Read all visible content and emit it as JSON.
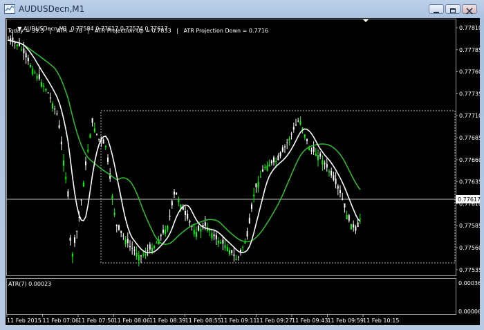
{
  "window": {
    "title": "AUDUSDecn,M1"
  },
  "main_chart": {
    "header_line1": "AUDUSDecn,M1  0.77584 0.77617 0.77574 0.77617",
    "header_line2": "Today = 39.5   |   ATR = 78   |   ATR Projection Up = 0.7833   |   ATR Projection Down = 0.7716",
    "price_labels": [
      "0.77810",
      "0.77785",
      "0.77760",
      "0.77735",
      "0.77710",
      "0.77685",
      "0.77660",
      "0.77635",
      "0.77610",
      "0.77585",
      "0.77560",
      "0.77535"
    ],
    "current_price": "0.77617",
    "colors": {
      "background": "#000000",
      "bull_candle": "#00ff00",
      "bear_candle": "#ffffff",
      "ma_fast": "#ffffff",
      "ma_slow": "#2eb82e",
      "grid_line": "#c0c0c0"
    }
  },
  "atr_panel": {
    "label": "ATR(7) 0.00023",
    "scale_top": "0.00036",
    "scale_bottom": "0.00006"
  },
  "time_axis": [
    "11 Feb 2015",
    "11 Feb 07:06",
    "11 Feb 07:50",
    "11 Feb 08:06",
    "11 Feb 08:39",
    "11 Feb 08:55",
    "11 Feb 09:11",
    "11 Feb 09:27",
    "11 Feb 09:43",
    "11 Feb 09:59",
    "11 Feb 10:15"
  ]
}
